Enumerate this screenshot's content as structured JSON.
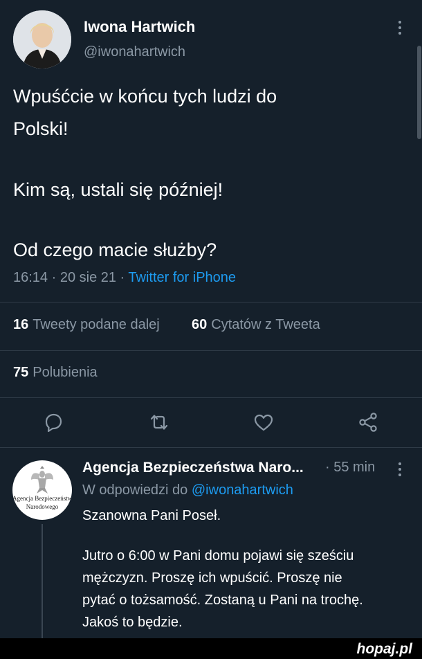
{
  "tweet": {
    "author_name": "Iwona Hartwich",
    "author_handle": "@iwonahartwich",
    "text_lines": [
      "Wpuśćcie w końcu tych ludzi do",
      "Polski!",
      "Kim są, ustali się później!",
      "Od czego macie służby?"
    ],
    "time": "16:14 · 20 sie 21 · ",
    "source": "Twitter for iPhone",
    "retweets_count": "16",
    "retweets_label": "Tweety podane dalej",
    "quotes_count": "60",
    "quotes_label": "Cytatów z Tweeta",
    "likes_count": "75",
    "likes_label": "Polubienia"
  },
  "actions": {
    "reply_icon": "reply-icon",
    "retweet_icon": "retweet-icon",
    "like_icon": "heart-icon",
    "share_icon": "share-icon"
  },
  "reply": {
    "author_name": "Agencja Bezpieczeństwa Naro...",
    "time": "· 55 min",
    "replying_prefix": "W odpowiedzi do ",
    "replying_handle": "@iwonahartwich",
    "avatar_text_1": "Agencja Bezpieczeństwa",
    "avatar_text_2": "Narodowego",
    "text_lines": [
      "Szanowna Pani Poseł.",
      "Jutro o 6:00 w Pani domu pojawi się sześciu",
      "mężczyzn. Proszę ich wpuścić. Proszę nie",
      "pytać o tożsamość. Zostaną u Pani na trochę.",
      "Jakoś to będzie."
    ]
  },
  "watermark": "hopaj.pl",
  "colors": {
    "background": "#15202b",
    "secondary_text": "#8b98a5",
    "link": "#1d9bf0"
  }
}
